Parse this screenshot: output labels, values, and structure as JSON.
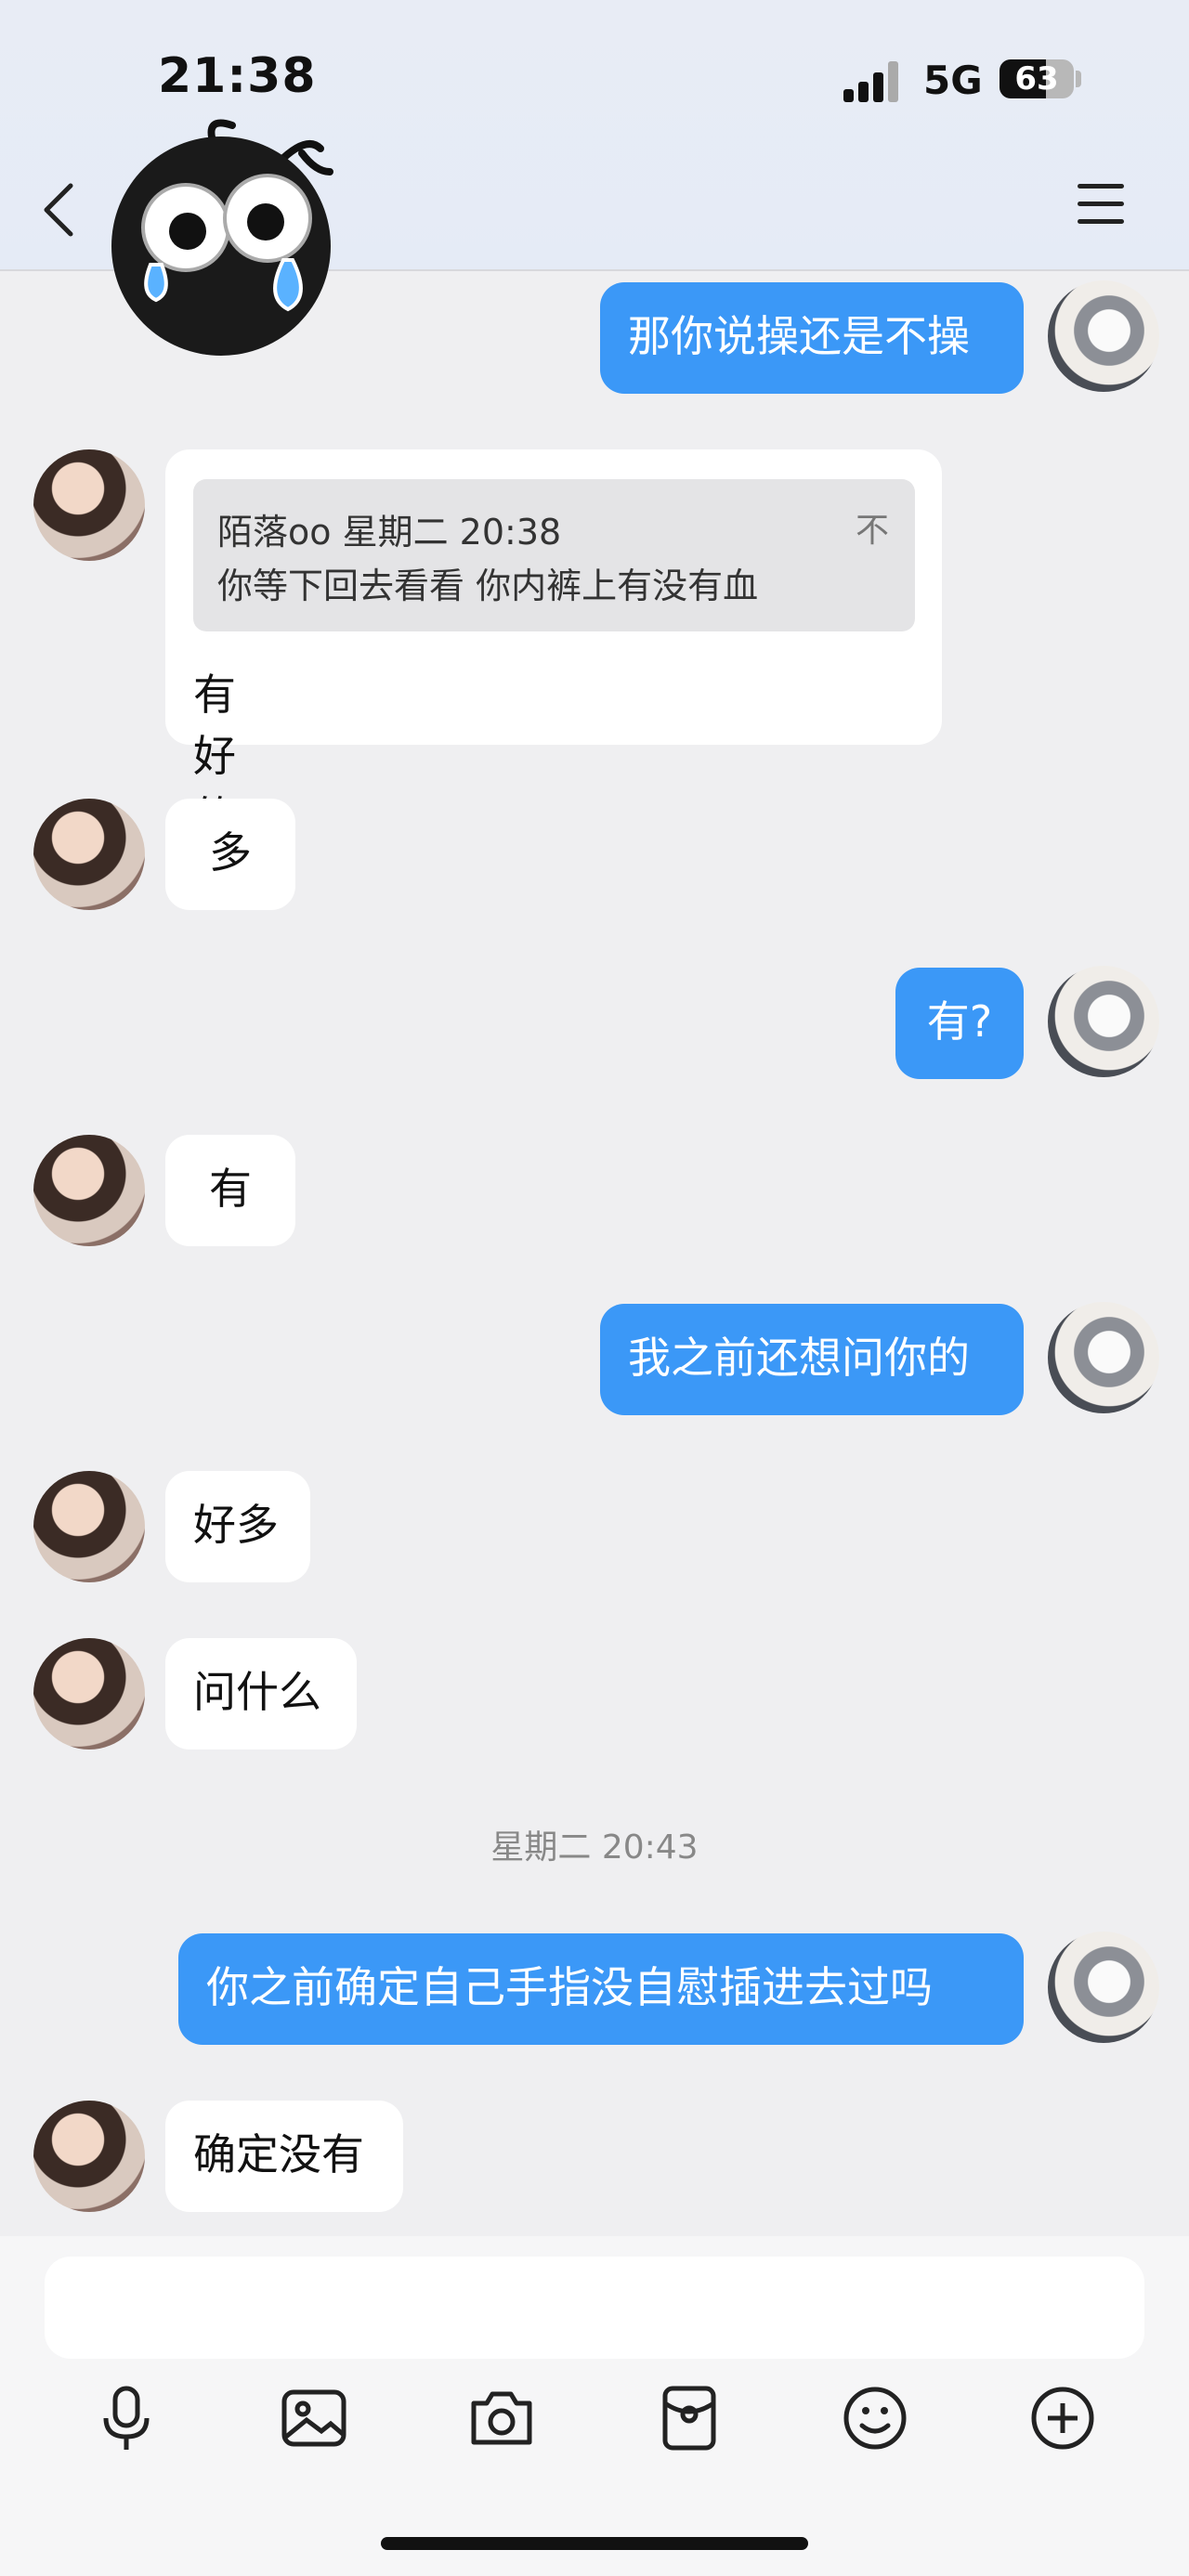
{
  "status_bar": {
    "time": "21:38",
    "network": "5G",
    "battery": "63"
  },
  "header": {
    "back_icon": "chevron-left-icon",
    "menu_icon": "hamburger-menu-icon",
    "sticker_icon": "crying-face-sticker-icon"
  },
  "messages": [
    {
      "side": "out",
      "text": "那你说操还是不操"
    },
    {
      "side": "in",
      "reply_to": {
        "meta": "陌落oo 星期二 20:38",
        "text": "你等下回去看看 你内裤上有没有血",
        "pin_icon": "pin-top-icon",
        "pin": "不"
      },
      "text": "有好的"
    },
    {
      "side": "in",
      "text": "多"
    },
    {
      "side": "out",
      "text": "有?"
    },
    {
      "side": "in",
      "text": "有"
    },
    {
      "side": "out",
      "text": "我之前还想问你的"
    },
    {
      "side": "in",
      "text": "好多"
    },
    {
      "side": "in",
      "text": "问什么"
    },
    {
      "timestamp": "星期二 20:43"
    },
    {
      "side": "out",
      "text": "你之前确定自己手指没自慰插进去过吗"
    },
    {
      "side": "in",
      "text": "确定没有"
    }
  ],
  "composer": {
    "input_value": "",
    "tools": [
      "microphone-icon",
      "image-icon",
      "camera-icon",
      "red-packet-icon",
      "emoji-icon",
      "plus-icon"
    ]
  }
}
